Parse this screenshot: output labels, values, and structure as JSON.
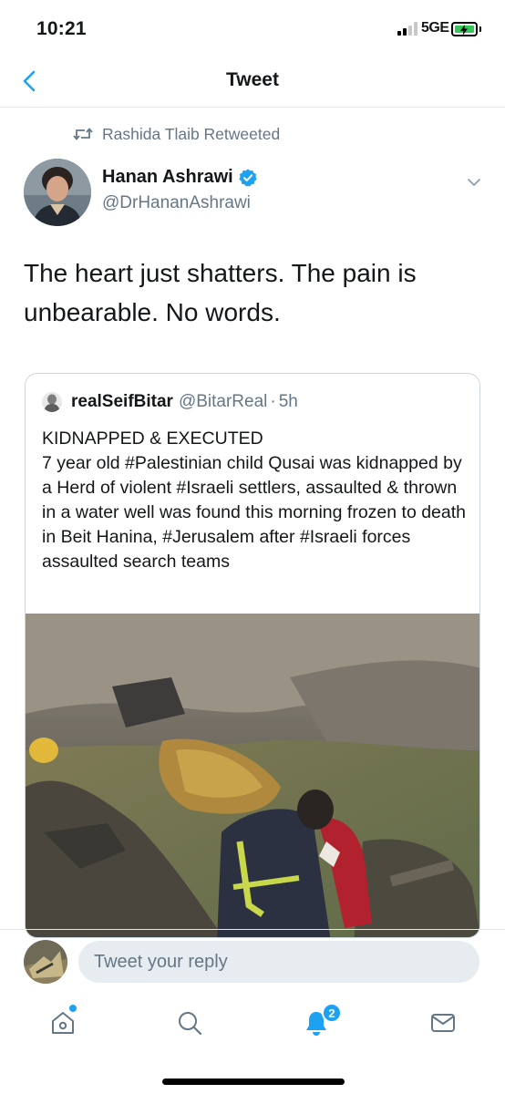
{
  "status_bar": {
    "time": "10:21",
    "network": "5GE",
    "signal_bars": 2
  },
  "nav": {
    "title": "Tweet"
  },
  "retweet_context": "Rashida Tlaib Retweeted",
  "author": {
    "name": "Hanan Ashrawi",
    "handle": "@DrHananAshrawi",
    "verified": true
  },
  "tweet": {
    "text": "The heart just shatters. The pain is unbearable. No words."
  },
  "quote": {
    "name": "realSeifBitar",
    "handle": "@BitarReal",
    "separator": "·",
    "time": "5h",
    "headline": "KIDNAPPED & EXECUTED",
    "text": "7 year old #Palestinian child Qusai was kidnapped by a Herd of violent #Israeli settlers, assaulted & thrown in a water well was found this morning frozen to death in Beit Hanina, #Jerusalem after #Israeli forces assaulted search teams"
  },
  "reply": {
    "placeholder": "Tweet your reply"
  },
  "tabs": [
    {
      "icon": "home-icon",
      "has_dot": true
    },
    {
      "icon": "search-icon"
    },
    {
      "icon": "notifications-icon",
      "badge": "2"
    },
    {
      "icon": "messages-icon"
    }
  ],
  "colors": {
    "accent": "#1da1f2",
    "secondary_text": "#657786",
    "border": "#e1e8ed"
  }
}
